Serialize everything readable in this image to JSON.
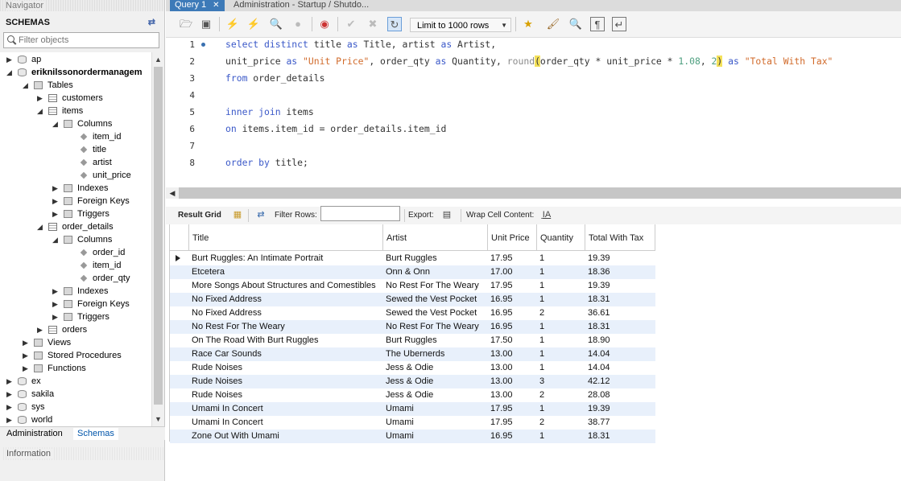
{
  "navigator": {
    "title": "Navigator",
    "schemas_label": "SCHEMAS",
    "filter_placeholder": "Filter objects",
    "tree": [
      {
        "label": "ap",
        "level": 0,
        "icon": "db",
        "expanded": false,
        "bold": false
      },
      {
        "label": "eriknilssonordermanagem",
        "level": 0,
        "icon": "db",
        "expanded": true,
        "bold": true
      },
      {
        "label": "Tables",
        "level": 1,
        "icon": "folder",
        "expanded": true,
        "bold": false
      },
      {
        "label": "customers",
        "level": 2,
        "icon": "table",
        "expanded": false,
        "bold": false
      },
      {
        "label": "items",
        "level": 2,
        "icon": "table",
        "expanded": true,
        "bold": false
      },
      {
        "label": "Columns",
        "level": 3,
        "icon": "folder",
        "expanded": true,
        "bold": false
      },
      {
        "label": "item_id",
        "level": 4,
        "icon": "column",
        "bold": false
      },
      {
        "label": "title",
        "level": 4,
        "icon": "column",
        "bold": false
      },
      {
        "label": "artist",
        "level": 4,
        "icon": "column",
        "bold": false
      },
      {
        "label": "unit_price",
        "level": 4,
        "icon": "column",
        "bold": false
      },
      {
        "label": "Indexes",
        "level": 3,
        "icon": "folder",
        "expanded": false,
        "bold": false
      },
      {
        "label": "Foreign Keys",
        "level": 3,
        "icon": "folder",
        "expanded": false,
        "bold": false
      },
      {
        "label": "Triggers",
        "level": 3,
        "icon": "folder",
        "expanded": false,
        "bold": false
      },
      {
        "label": "order_details",
        "level": 2,
        "icon": "table",
        "expanded": true,
        "bold": false
      },
      {
        "label": "Columns",
        "level": 3,
        "icon": "folder",
        "expanded": true,
        "bold": false
      },
      {
        "label": "order_id",
        "level": 4,
        "icon": "column",
        "bold": false
      },
      {
        "label": "item_id",
        "level": 4,
        "icon": "column",
        "bold": false
      },
      {
        "label": "order_qty",
        "level": 4,
        "icon": "column",
        "bold": false
      },
      {
        "label": "Indexes",
        "level": 3,
        "icon": "folder",
        "expanded": false,
        "bold": false
      },
      {
        "label": "Foreign Keys",
        "level": 3,
        "icon": "folder",
        "expanded": false,
        "bold": false
      },
      {
        "label": "Triggers",
        "level": 3,
        "icon": "folder",
        "expanded": false,
        "bold": false
      },
      {
        "label": "orders",
        "level": 2,
        "icon": "table",
        "expanded": false,
        "bold": false
      },
      {
        "label": "Views",
        "level": 1,
        "icon": "folder",
        "bold": false
      },
      {
        "label": "Stored Procedures",
        "level": 1,
        "icon": "folder",
        "bold": false
      },
      {
        "label": "Functions",
        "level": 1,
        "icon": "folder",
        "bold": false
      },
      {
        "label": "ex",
        "level": 0,
        "icon": "db",
        "expanded": false,
        "bold": false
      },
      {
        "label": "sakila",
        "level": 0,
        "icon": "db",
        "expanded": false,
        "bold": false
      },
      {
        "label": "sys",
        "level": 0,
        "icon": "db",
        "expanded": false,
        "bold": false
      },
      {
        "label": "world",
        "level": 0,
        "icon": "db",
        "expanded": false,
        "bold": false
      }
    ],
    "bottom_tabs": [
      "Administration",
      "Schemas"
    ],
    "active_bottom_tab": "Schemas",
    "information_label": "Information"
  },
  "query_tabs": [
    {
      "label": "Query 1",
      "active": true
    },
    {
      "label": "Administration - Startup / Shutdo...",
      "active": false
    }
  ],
  "toolbar": {
    "limit_label": "Limit to 1000 rows"
  },
  "editor": {
    "line_numbers": [
      "1",
      "2",
      "3",
      "4",
      "5",
      "6",
      "7",
      "8"
    ]
  },
  "results_toolbar": {
    "result_grid": "Result Grid",
    "filter_rows": "Filter Rows:",
    "export": "Export:",
    "wrap_cell": "Wrap Cell Content:"
  },
  "grid": {
    "columns": [
      "Title",
      "Artist",
      "Unit Price",
      "Quantity",
      "Total With Tax"
    ],
    "rows": [
      [
        "Burt Ruggles: An Intimate Portrait",
        "Burt Ruggles",
        "17.95",
        "1",
        "19.39"
      ],
      [
        "Etcetera",
        "Onn & Onn",
        "17.00",
        "1",
        "18.36"
      ],
      [
        "More Songs About Structures and Comestibles",
        "No Rest For The Weary",
        "17.95",
        "1",
        "19.39"
      ],
      [
        "No Fixed Address",
        "Sewed the Vest Pocket",
        "16.95",
        "1",
        "18.31"
      ],
      [
        "No Fixed Address",
        "Sewed the Vest Pocket",
        "16.95",
        "2",
        "36.61"
      ],
      [
        "No Rest For The Weary",
        "No Rest For The Weary",
        "16.95",
        "1",
        "18.31"
      ],
      [
        "On The Road With Burt Ruggles",
        "Burt Ruggles",
        "17.50",
        "1",
        "18.90"
      ],
      [
        "Race Car Sounds",
        "The Ubernerds",
        "13.00",
        "1",
        "14.04"
      ],
      [
        "Rude Noises",
        "Jess & Odie",
        "13.00",
        "1",
        "14.04"
      ],
      [
        "Rude Noises",
        "Jess & Odie",
        "13.00",
        "3",
        "42.12"
      ],
      [
        "Rude Noises",
        "Jess & Odie",
        "13.00",
        "2",
        "28.08"
      ],
      [
        "Umami In Concert",
        "Umami",
        "17.95",
        "1",
        "19.39"
      ],
      [
        "Umami In Concert",
        "Umami",
        "17.95",
        "2",
        "38.77"
      ],
      [
        "Zone Out With Umami",
        "Umami",
        "16.95",
        "1",
        "18.31"
      ]
    ]
  }
}
